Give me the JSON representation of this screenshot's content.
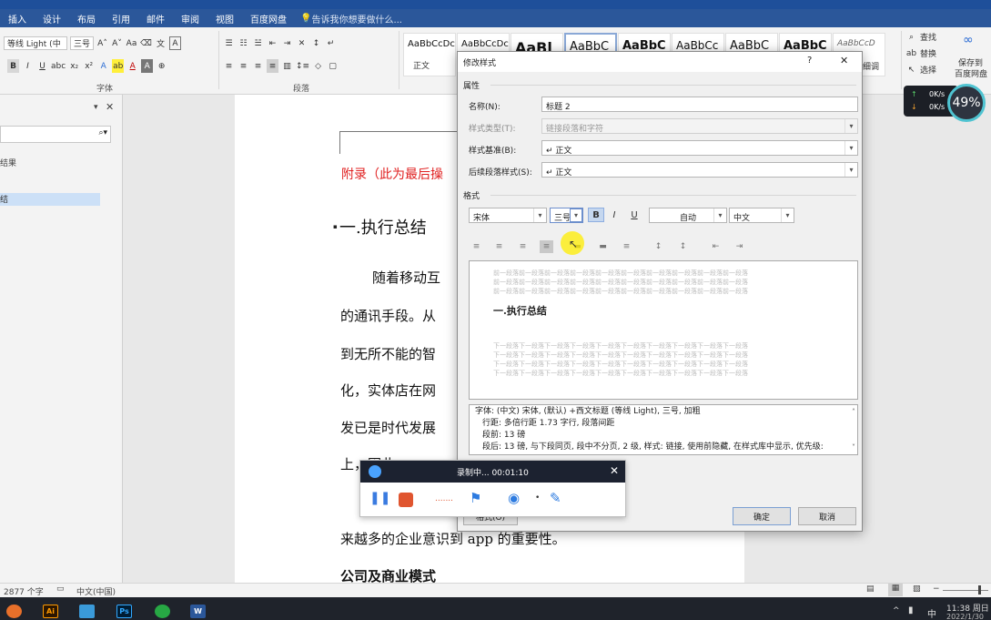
{
  "ribbon_tabs": [
    "插入",
    "设计",
    "布局",
    "引用",
    "邮件",
    "审阅",
    "视图",
    "百度网盘"
  ],
  "tell_me": "告诉我你想要做什么...",
  "font_name": "等线 Light (中",
  "font_size": "三号",
  "font_group_label": "字体",
  "paragraph_group_label": "段落",
  "style_gallery": [
    {
      "sample": "AaBbCcDc",
      "name": "正文"
    },
    {
      "sample": "AaBbCcDc",
      "name": ""
    },
    {
      "sample": "AaBl",
      "name": ""
    },
    {
      "sample": "AaBbC",
      "name": ""
    },
    {
      "sample": "AaBbC",
      "name": ""
    },
    {
      "sample": "AaBbCc",
      "name": ""
    },
    {
      "sample": "AaBbC",
      "name": ""
    },
    {
      "sample": "AaBbC",
      "name": ""
    },
    {
      "sample": "AaBbCcD",
      "name": ""
    }
  ],
  "right_ribbon": {
    "find": "查找",
    "replace": "替换",
    "select": "选择",
    "save_baidu_1": "保存到",
    "save_baidu_2": "百度网盘",
    "partial": "细调"
  },
  "nav_pane": {
    "result_text": "结果",
    "selected_text": "结"
  },
  "document": {
    "appendix": "附录（此为最后操",
    "heading": "一.执行总结",
    "lines": [
      "随着移动互",
      "的通讯手段。从",
      "到无所不能的智",
      "化，实体店在网",
      "发已是时代发展",
      "上，因此"
    ],
    "line7": "来越多的企业意识到 app 的重要性。",
    "line8": "公司及商业模式"
  },
  "dialog": {
    "title": "修改样式",
    "help": "?",
    "close": "✕",
    "section_props": "属性",
    "name_label": "名称(N):",
    "name_value": "标题 2",
    "type_label": "样式类型(T):",
    "type_value": "链接段落和字符",
    "based_label": "样式基准(B):",
    "based_value": "↵ 正文",
    "next_label": "后续段落样式(S):",
    "next_value": "↵ 正文",
    "section_format": "格式",
    "font": "宋体",
    "size": "三号",
    "bold": "B",
    "italic": "I",
    "underline": "U",
    "color": "自动",
    "script": "中文",
    "preview_before": "前一段落前一段落前一段落前一段落前一段落前一段落前一段落前一段落前一段落前一段落",
    "preview_heading": "一.执行总结",
    "preview_after": "下一段落下一段落下一段落下一段落下一段落下一段落下一段落下一段落下一段落下一段落",
    "desc_lines": [
      "字体: (中文) 宋体, (默认) +西文标题 (等线 Light), 三号, 加粗",
      "行距: 多倍行距 1.73 字行, 段落间距",
      "段前: 13 磅",
      "段后: 13 磅, 与下段同页, 段中不分页, 2 级, 样式: 链接, 使用前隐藏, 在样式库中显示, 优先级:"
    ],
    "format_btn": "格式(O)",
    "ok": "确定",
    "cancel": "取消"
  },
  "recorder": {
    "status": "录制中... 00:01:10",
    "close": "✕"
  },
  "speed": {
    "up": "0K/s",
    "down": "0K/s",
    "percent": "49%"
  },
  "status": {
    "chars": "2877 个字",
    "lang": "中文(中国)"
  },
  "tray": {
    "ime": "中",
    "time": "11:38 周日",
    "date": "2022/1/30"
  }
}
